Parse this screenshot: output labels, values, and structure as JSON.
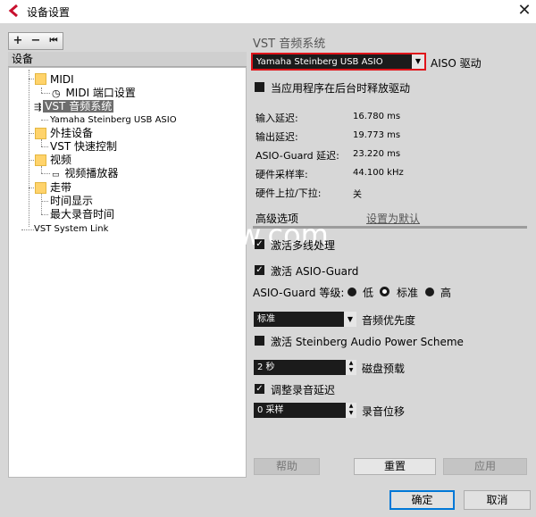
{
  "window": {
    "title": "设备设置",
    "close_icon": "close-icon"
  },
  "toolbar": {
    "add": "+",
    "remove": "−",
    "reset": "⏮"
  },
  "tree": {
    "header": "设备",
    "items": [
      {
        "label": "MIDI"
      },
      {
        "label": "MIDI 端口设置"
      },
      {
        "label": "VST 音频系统"
      },
      {
        "label": "Yamaha Steinberg USB ASIO"
      },
      {
        "label": "外挂设备"
      },
      {
        "label": "VST 快速控制"
      },
      {
        "label": "视频"
      },
      {
        "label": "视频播放器"
      },
      {
        "label": "走带"
      },
      {
        "label": "时间显示"
      },
      {
        "label": "最大录音时间"
      },
      {
        "label": "VST System Link"
      }
    ]
  },
  "vst": {
    "title": "VST 音频系统",
    "driver_value": "Yamaha Steinberg USB ASIO",
    "driver_label": "AISO 驱动",
    "release_label": "当应用程序在后台时释放驱动",
    "rows": [
      {
        "label": "输入延迟:",
        "value": "16.780 ms"
      },
      {
        "label": "输出延迟:",
        "value": "19.773 ms"
      },
      {
        "label": "ASIO-Guard 延迟:",
        "value": "23.220 ms"
      },
      {
        "label": "硬件采样率:",
        "value": "44.100 kHz"
      },
      {
        "label": "硬件上拉/下拉:",
        "value": "关"
      }
    ],
    "tab_advanced": "高级选项",
    "tab_default": "设置为默认",
    "multithread_label": "激活多线处理",
    "asio_guard_label": "激活 ASIO-Guard",
    "guard_level_label": "ASIO-Guard 等级:",
    "levels": [
      "低",
      "标准",
      "高"
    ],
    "priority_value": "标准",
    "priority_label": "音频优先度",
    "power_label": "激活 Steinberg Audio Power Scheme",
    "disk_value": "2 秒",
    "disk_label": "磁盘预载",
    "adjust_label": "调整录音延迟",
    "offset_value": "0 采样",
    "offset_label": "录音位移",
    "help": "帮助",
    "reset": "重置",
    "apply": "应用"
  },
  "dialog": {
    "ok": "确定",
    "cancel": "取消"
  },
  "watermark": "jiqw.com"
}
